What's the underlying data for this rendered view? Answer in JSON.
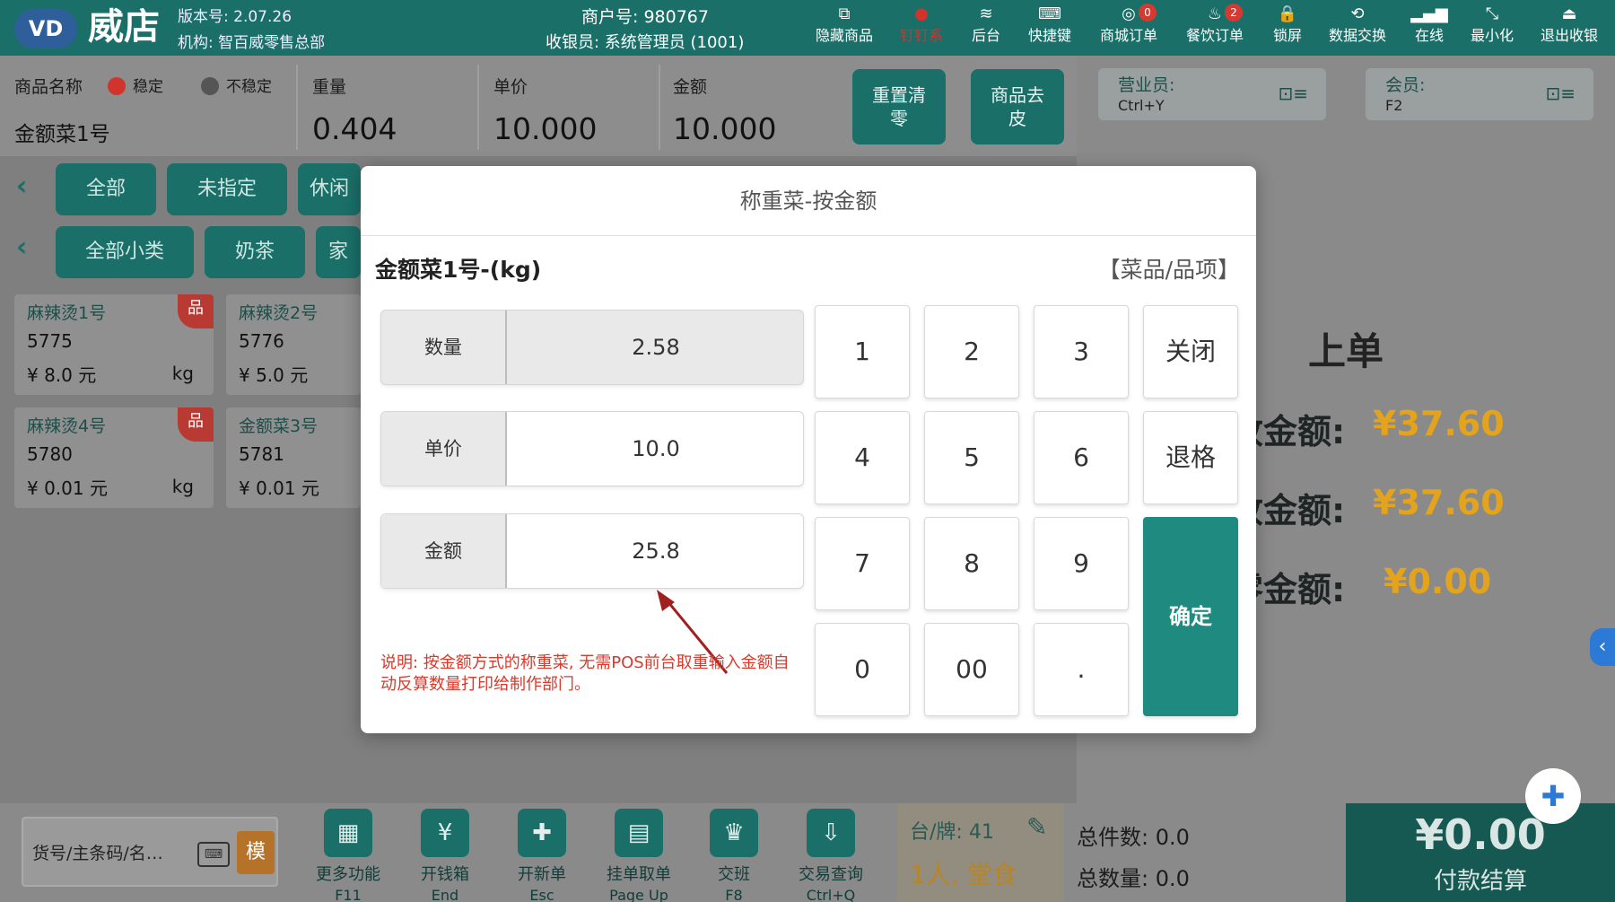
{
  "topbar": {
    "logo_mark": "VD",
    "logo_text": "威店",
    "version": "版本号: 2.07.26",
    "org": "机构: 智百威零售总部",
    "merchant": "商户号: 980767",
    "cashier": "收银员: 系统管理员 (1001)",
    "menu": [
      {
        "label": "隐藏商品",
        "icon": "hide-goods-icon",
        "glyph": "⧉"
      },
      {
        "label": "钉钉系",
        "icon": "red-status-icon",
        "glyph": "●"
      },
      {
        "label": "后台",
        "icon": "layers-icon",
        "glyph": "≋"
      },
      {
        "label": "快捷键",
        "icon": "keyboard-icon",
        "glyph": "⌨"
      },
      {
        "label": "商城订单",
        "icon": "mall-order-icon",
        "glyph": "◎",
        "badge": "0"
      },
      {
        "label": "餐饮订单",
        "icon": "dining-order-icon",
        "glyph": "♨",
        "badge": "2"
      },
      {
        "label": "锁屏",
        "icon": "lock-icon",
        "glyph": "🔒"
      },
      {
        "label": "数据交换",
        "icon": "data-exchange-icon",
        "glyph": "⟲"
      },
      {
        "label": "在线",
        "icon": "signal-icon",
        "glyph": "▂▄▆"
      },
      {
        "label": "最小化",
        "icon": "minimize-icon",
        "glyph": "⤡"
      },
      {
        "label": "退出收银",
        "icon": "exit-icon",
        "glyph": "⏏"
      }
    ]
  },
  "weigh": {
    "product_label": "商品名称",
    "stable_label": "稳定",
    "unstable_label": "不稳定",
    "product_name": "金额菜1号",
    "weight_label": "重量",
    "weight_value": "0.404",
    "price_label": "单价",
    "price_value": "10.000",
    "amount_label": "金额",
    "amount_value": "10.000",
    "reset_btn": "重置清零",
    "tare_btn": "商品去皮",
    "stable_color": "#d0342c",
    "unstable_color": "#555555"
  },
  "staff": {
    "salesperson_label": "营业员:",
    "salesperson_key": "Ctrl+Y",
    "member_label": "会员:",
    "member_key": "F2"
  },
  "categories": {
    "row1": [
      "全部",
      "未指定",
      "休闲"
    ],
    "row2": [
      "全部小类",
      "奶茶",
      "家"
    ]
  },
  "products": [
    {
      "name": "麻辣烫1号",
      "code": "5775",
      "price": "¥ 8.0 元",
      "unit": "kg",
      "badge": "品"
    },
    {
      "name": "麻辣烫2号",
      "code": "5776",
      "price": "¥ 5.0 元",
      "unit": "",
      "badge": ""
    },
    {
      "name": "麻辣烫4号",
      "code": "5780",
      "price": "¥ 0.01 元",
      "unit": "kg",
      "badge": "品"
    },
    {
      "name": "金额菜3号",
      "code": "5781",
      "price": "¥ 0.01 元",
      "unit": "",
      "badge": ""
    }
  ],
  "summary": {
    "title": "上单",
    "receivable_label": "收金额:",
    "receivable_value": "¥37.60",
    "received_label": "收金额:",
    "received_value": "¥37.60",
    "change_label": "零金额:",
    "change_value": "¥0.00"
  },
  "modal": {
    "title": "称重菜-按金额",
    "product": "金额菜1号-(kg)",
    "category": "【菜品/品项】",
    "qty_label": "数量",
    "qty_value": "2.58",
    "price_label": "单价",
    "price_value": "10.0",
    "amount_label": "金额",
    "amount_value": "25.8",
    "note": "说明: 按金额方式的称重菜, 无需POS前台取重输入金额自动反算数量打印给制作部门。",
    "keys": {
      "k1": "1",
      "k2": "2",
      "k3": "3",
      "close": "关闭",
      "k4": "4",
      "k5": "5",
      "k6": "6",
      "backspace": "退格",
      "k7": "7",
      "k8": "8",
      "k9": "9",
      "confirm": "确定",
      "k0": "0",
      "k00": "00",
      "dot": "."
    }
  },
  "bottom": {
    "search_placeholder": "货号/主条码/名…",
    "keyboard_glyph": "⌨",
    "mode_label": "模",
    "functions": [
      {
        "label": "更多功能",
        "key": "F11",
        "icon": "more-functions-icon",
        "glyph": "▦"
      },
      {
        "label": "开钱箱",
        "key": "End",
        "icon": "cash-drawer-icon",
        "glyph": "¥"
      },
      {
        "label": "开新单",
        "key": "Esc",
        "icon": "new-order-icon",
        "glyph": "✚"
      },
      {
        "label": "挂单取单",
        "key": "Page Up",
        "icon": "hold-order-icon",
        "glyph": "▤"
      },
      {
        "label": "交班",
        "key": "F8",
        "icon": "crown-icon",
        "glyph": "♛"
      },
      {
        "label": "交易查询",
        "key": "Ctrl+Q",
        "icon": "transaction-query-icon",
        "glyph": "⇩"
      }
    ],
    "table_label": "台/牌: 41",
    "people": "1人, 堂食",
    "total_items": "总件数: 0.0",
    "total_qty": "总数量: 0.0",
    "pay_amount": "¥0.00",
    "pay_label": "付款结算"
  }
}
